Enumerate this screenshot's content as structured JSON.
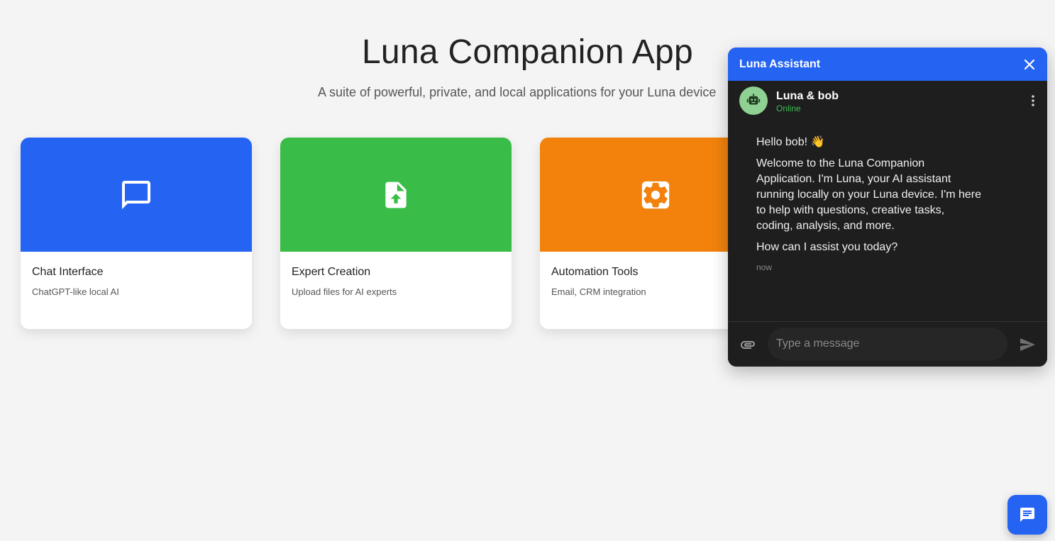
{
  "page": {
    "title": "Luna Companion App",
    "subtitle": "A suite of powerful, private, and local applications for your Luna device"
  },
  "cards": [
    {
      "title": "Chat Interface",
      "description": "ChatGPT-like local AI",
      "color": "#2563f3",
      "icon": "chat-bubble-icon"
    },
    {
      "title": "Expert Creation",
      "description": "Upload files for AI experts",
      "color": "#39bd48",
      "icon": "file-upload-icon"
    },
    {
      "title": "Automation Tools",
      "description": "Email, CRM integration",
      "color": "#f2820c",
      "icon": "gear-icon"
    }
  ],
  "chat": {
    "header_title": "Luna Assistant",
    "contact_name": "Luna & bob",
    "contact_status": "Online",
    "messages": [
      {
        "greeting": "Hello bob! 👋",
        "body": "Welcome to the Luna Companion Application. I'm Luna, your AI assistant running locally on your Luna device. I'm here to help with questions, creative tasks, coding, analysis, and more.",
        "question": "How can I assist you today?",
        "time": "now"
      }
    ],
    "input_placeholder": "Type a message",
    "accent": "#2563f3",
    "status_color": "#3bbf50"
  }
}
